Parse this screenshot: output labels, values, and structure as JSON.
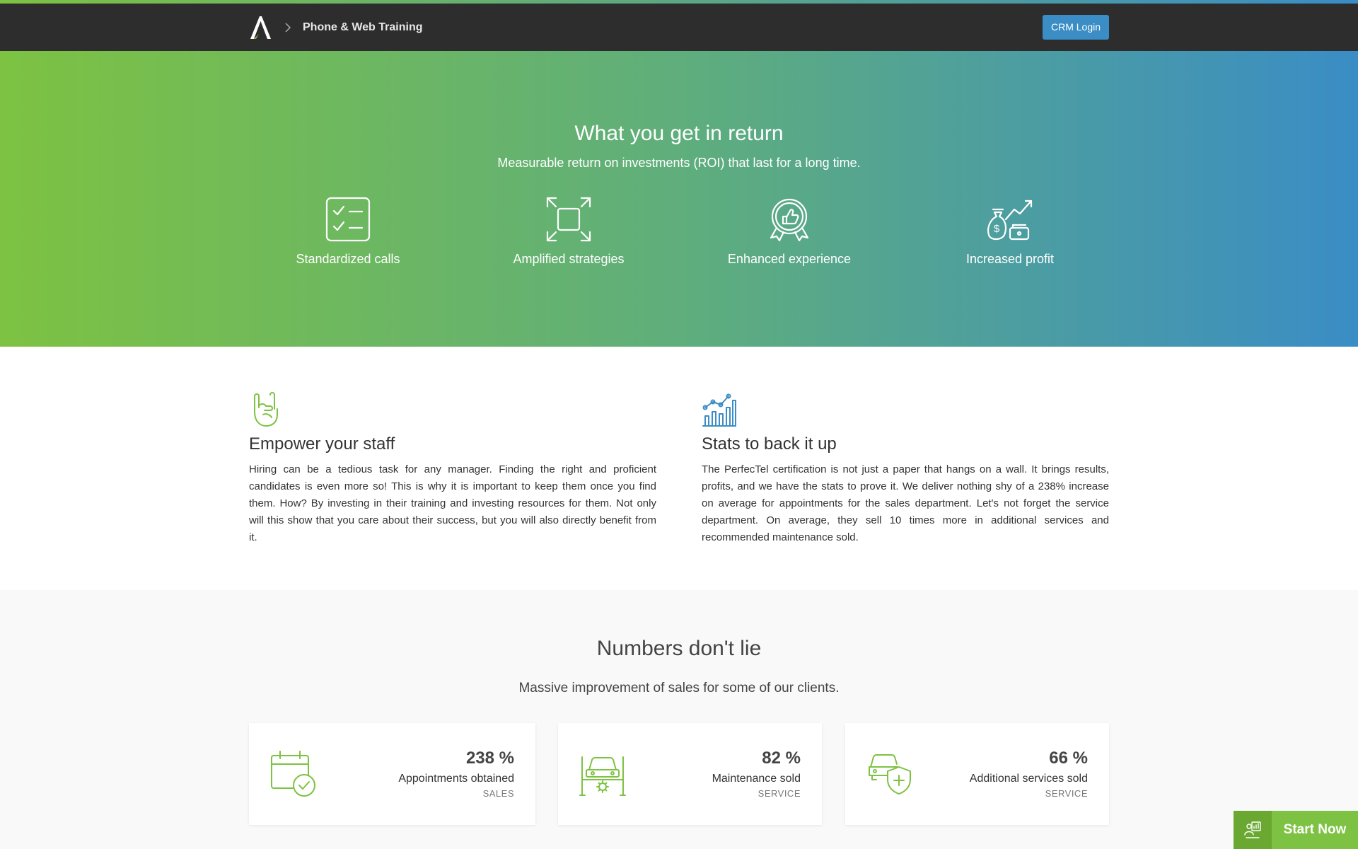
{
  "header": {
    "breadcrumb_title": "Phone & Web Training",
    "crm_button": "CRM Login"
  },
  "hero": {
    "title": "What you get in return",
    "subtitle": "Measurable return on investments (ROI) that last for a long time.",
    "features": [
      {
        "label": "Standardized calls",
        "icon": "checklist-icon"
      },
      {
        "label": "Amplified strategies",
        "icon": "expand-icon"
      },
      {
        "label": "Enhanced experience",
        "icon": "award-thumbs-up-icon"
      },
      {
        "label": "Increased profit",
        "icon": "money-bag-growth-icon"
      }
    ]
  },
  "columns": [
    {
      "icon": "rock-hand-icon",
      "title": "Empower your staff",
      "text": "Hiring can be a tedious task for any manager. Finding the right and proficient candidates is even more so! This is why it is important to keep them once you find them. How? By investing in their training and investing resources for them. Not only will this show that you care about their success, but you will also directly benefit from it."
    },
    {
      "icon": "stats-chart-icon",
      "title": "Stats to back it up",
      "text": "The PerfecTel certification is not just a paper that hangs on a wall. It brings results, profits, and we have the stats to prove it. We deliver nothing shy of a 238% increase on average for appointments for the sales department. Let's not forget the service department. On average, they sell 10 times more in additional services and recommended maintenance sold."
    }
  ],
  "numbers": {
    "title": "Numbers don't lie",
    "subtitle": "Massive improvement of sales for some of our clients.",
    "cards": [
      {
        "value": "238 %",
        "label": "Appointments obtained",
        "category": "SALES",
        "icon": "calendar-check-icon"
      },
      {
        "value": "82 %",
        "label": "Maintenance sold",
        "category": "SERVICE",
        "icon": "car-lift-icon"
      },
      {
        "value": "66 %",
        "label": "Additional services sold",
        "category": "SERVICE",
        "icon": "car-shield-icon"
      }
    ]
  },
  "start_now": {
    "label": "Start Now",
    "icon": "person-chart-icon"
  },
  "colors": {
    "green": "#7dc242",
    "blue": "#3a8dc5",
    "navbar": "#2d2d2d"
  }
}
